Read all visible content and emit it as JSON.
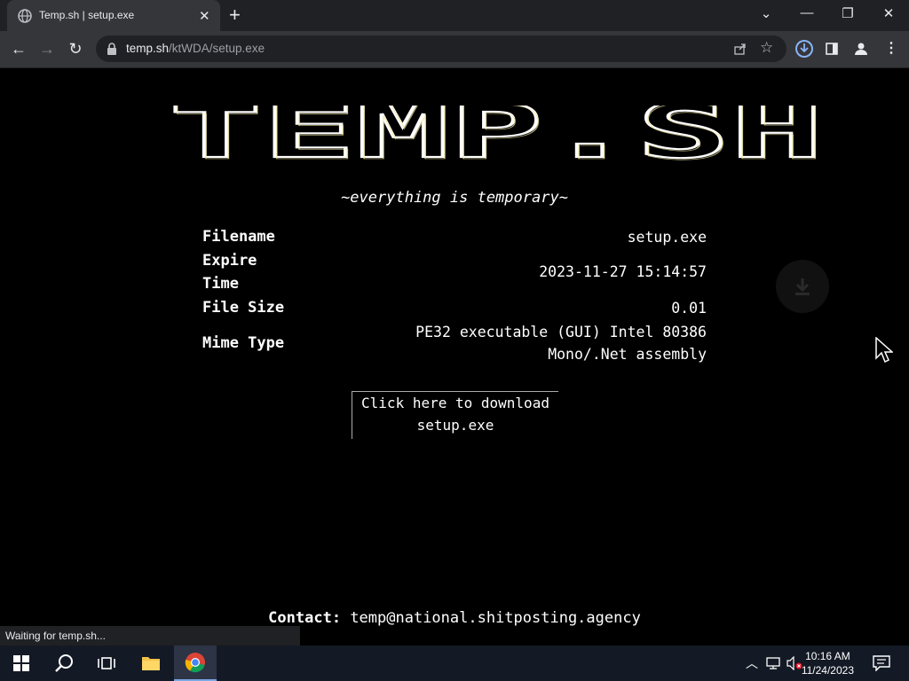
{
  "browser": {
    "tab_title": "Temp.sh | setup.exe",
    "url_host": "temp.sh",
    "url_path": "/ktWDA/setup.exe",
    "status_text": "Waiting for temp.sh..."
  },
  "page": {
    "logo_text": "TEMP.SH",
    "tagline": "~everything is temporary~",
    "file_info": {
      "filename_label": "Filename",
      "filename_value": "setup.exe",
      "expire_label_line1": "Expire",
      "expire_label_line2": "Time",
      "expire_value": "2023-11-27 15:14:57",
      "size_label": "File Size",
      "size_value": "0.01",
      "mime_label": "Mime Type",
      "mime_value_line1": "PE32 executable (GUI) Intel 80386",
      "mime_value_line2": "Mono/.Net assembly"
    },
    "download_line1": "Click here to download",
    "download_line2": "setup.exe",
    "contact_label": "Contact:",
    "contact_email": "temp@national.shitposting.agency"
  },
  "taskbar": {
    "time": "10:16 AM",
    "date": "11/24/2023"
  },
  "icons": [
    "globe-icon",
    "close-icon",
    "plus-icon",
    "back-icon",
    "forward-icon",
    "reload-icon",
    "lock-icon",
    "share-icon",
    "star-icon",
    "download-icon",
    "sidepanel-icon",
    "profile-icon",
    "menu-icon",
    "windows-icon",
    "search-icon",
    "taskview-icon",
    "folder-icon",
    "chrome-icon",
    "notification-icon"
  ]
}
